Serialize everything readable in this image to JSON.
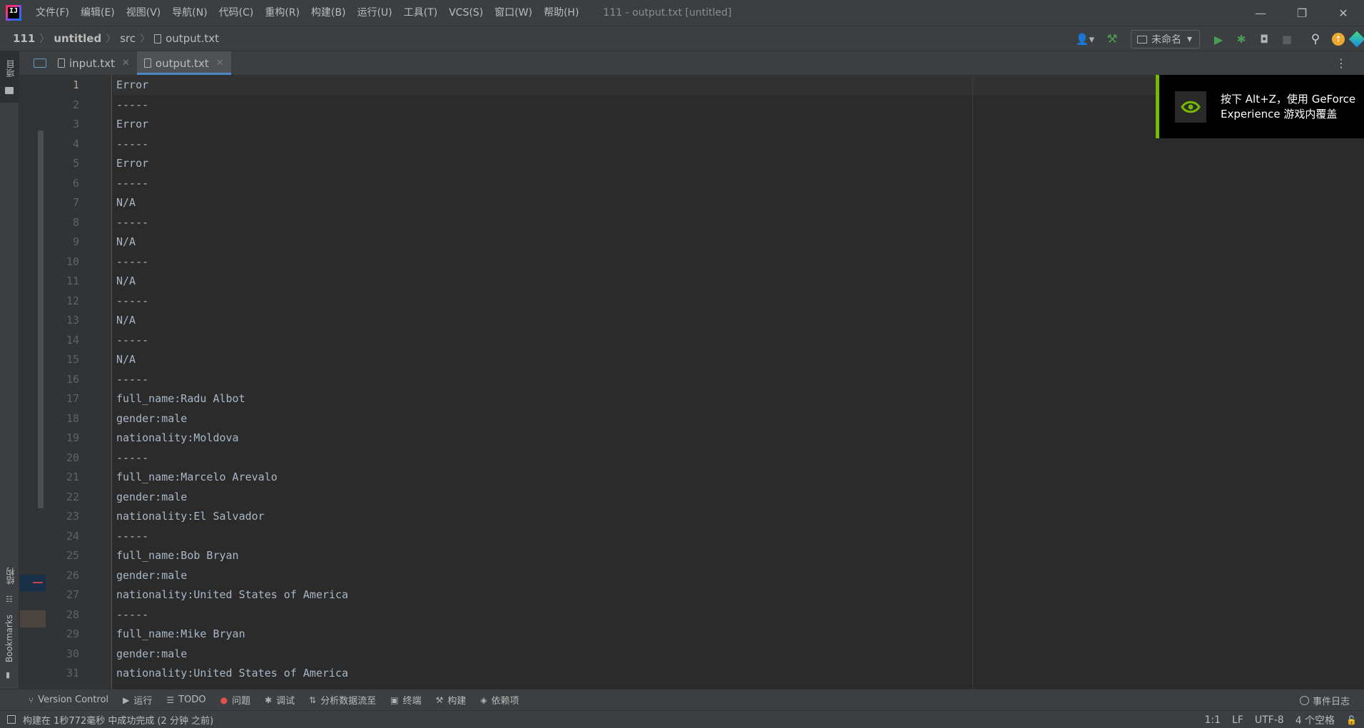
{
  "app": {
    "logo_text": "IJ"
  },
  "menu": [
    "文件(F)",
    "编辑(E)",
    "视图(V)",
    "导航(N)",
    "代码(C)",
    "重构(R)",
    "构建(B)",
    "运行(U)",
    "工具(T)",
    "VCS(S)",
    "窗口(W)",
    "帮助(H)"
  ],
  "window_title": "111 - output.txt [untitled]",
  "breadcrumb": {
    "project": "111",
    "module": "untitled",
    "folder": "src",
    "file": "output.txt"
  },
  "run_config": {
    "label": "未命名"
  },
  "left_tabs": {
    "project": "项目",
    "structure": "结构",
    "bookmarks": "Bookmarks"
  },
  "tabs": [
    {
      "label": "input.txt",
      "active": false
    },
    {
      "label": "output.txt",
      "active": true
    }
  ],
  "editor": {
    "lines": [
      "Error",
      "-----",
      "Error",
      "-----",
      "Error",
      "-----",
      "N/A",
      "-----",
      "N/A",
      "-----",
      "N/A",
      "-----",
      "N/A",
      "-----",
      "N/A",
      "-----",
      "full_name:Radu Albot",
      "gender:male",
      "nationality:Moldova",
      "-----",
      "full_name:Marcelo Arevalo",
      "gender:male",
      "nationality:El Salvador",
      "-----",
      "full_name:Bob Bryan",
      "gender:male",
      "nationality:United States of America",
      "-----",
      "full_name:Mike Bryan",
      "gender:male",
      "nationality:United States of America"
    ],
    "current_line": 1
  },
  "overlay": {
    "line1": "按下 Alt+Z，使用 GeForce",
    "line2": "Experience 游戏内覆盖"
  },
  "tool_windows": [
    {
      "label": "Version Control",
      "icon": "version-control-icon"
    },
    {
      "label": "运行",
      "icon": "run-icon"
    },
    {
      "label": "TODO",
      "icon": "todo-icon"
    },
    {
      "label": "问题",
      "icon": "problems-icon"
    },
    {
      "label": "调试",
      "icon": "debug-icon"
    },
    {
      "label": "分析数据流至",
      "icon": "dataflow-icon"
    },
    {
      "label": "终端",
      "icon": "terminal-icon"
    },
    {
      "label": "构建",
      "icon": "build-icon"
    },
    {
      "label": "依赖项",
      "icon": "dependencies-icon"
    }
  ],
  "event_log": "事件日志",
  "status": {
    "message": "构建在 1秒772毫秒 中成功完成 (2 分钟 之前)",
    "position": "1:1",
    "line_sep": "LF",
    "encoding": "UTF-8",
    "indent": "4 个空格"
  },
  "colors": {
    "accent": "#4a88c7",
    "nvidia_green": "#76b900",
    "run_green": "#499c54"
  }
}
